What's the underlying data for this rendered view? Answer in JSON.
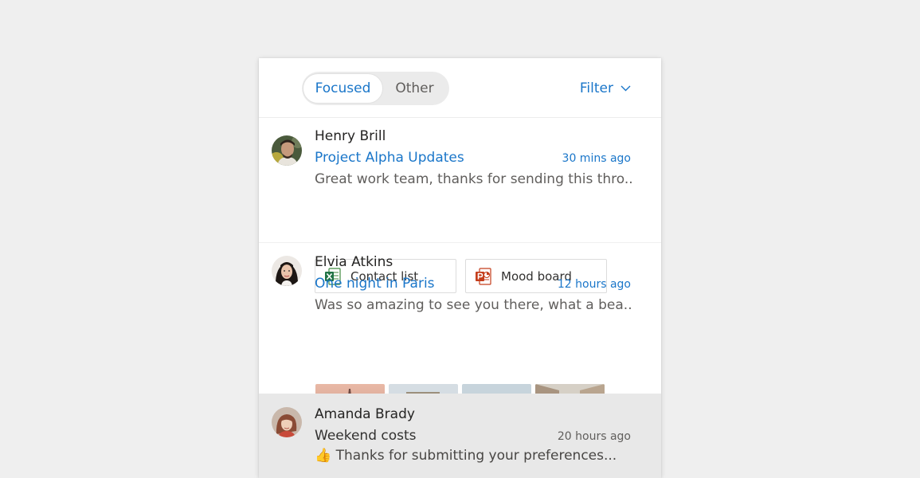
{
  "tabs": {
    "focused": "Focused",
    "other": "Other"
  },
  "filter": {
    "label": "Filter",
    "icon": "chevron-down-icon"
  },
  "colors": {
    "accent": "#1a76c9",
    "selected_row": "#e8e8e8",
    "background": "#efefef"
  },
  "messages": [
    {
      "sender": "Henry Brill",
      "subject": "Project Alpha Updates",
      "time": "30 mins ago",
      "preview": "Great work team, thanks for sending this thro...",
      "unread": true,
      "attachments": [
        {
          "name": "Contact list",
          "icon": "excel-file-icon"
        },
        {
          "name": "Mood board",
          "icon": "powerpoint-file-icon"
        }
      ]
    },
    {
      "sender": "Elvia Atkins",
      "subject": "One night in Paris",
      "time": "12 hours ago",
      "preview": "Was so amazing to see you there, what a bea...",
      "unread": true,
      "photos": [
        "eiffel-tower-photo",
        "arc-de-triomphe-photo",
        "champs-elysees-photo",
        "paris-street-photo"
      ]
    },
    {
      "sender": "Amanda Brady",
      "subject": "Weekend costs",
      "time": "20 hours ago",
      "preview": "👍 Thanks for submitting your preferences...",
      "unread": false,
      "selected": true
    }
  ]
}
